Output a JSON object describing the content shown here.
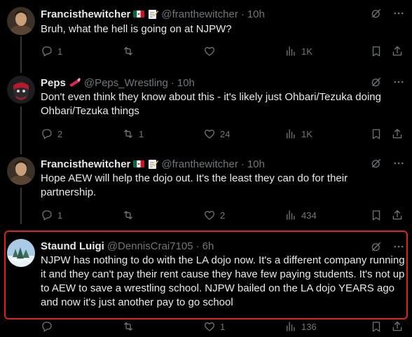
{
  "tweets": [
    {
      "name": "Francisthewitcher",
      "handle": "@franthewitcher",
      "time": "10h",
      "text": "Bruh, what the hell is going on at NJPW?",
      "replies": "1",
      "retweets": "",
      "likes": "",
      "views": "1K"
    },
    {
      "name": "Peps",
      "handle": "@Peps_Wrestling",
      "time": "10h",
      "text": "Don't even think they know about this - it's likely just Ohbari/Tezuka doing Ohbari/Tezuka things",
      "replies": "2",
      "retweets": "1",
      "likes": "24",
      "views": "1K"
    },
    {
      "name": "Francisthewitcher",
      "handle": "@franthewitcher",
      "time": "10h",
      "text": "Hope AEW will help the dojo out. It's the least they can do for their partnership.",
      "replies": "1",
      "retweets": "",
      "likes": "2",
      "views": "434"
    },
    {
      "name": "Staund Luigi",
      "handle": "@DennisCrai7105",
      "time": "6h",
      "text": "NJPW has nothing to do with the LA dojo now. It's a different company running it and they can't pay their rent cause they have few paying students. It's not up to AEW to save a wrestling school. NJPW bailed on the LA dojo YEARS ago and now it's just another pay to go school",
      "replies": "",
      "retweets": "",
      "likes": "1",
      "views": "136"
    }
  ],
  "separator": "·",
  "colors": {
    "background": "#000000",
    "text": "#e7e9ea",
    "muted": "#71767b",
    "highlight_border": "#d9231d"
  },
  "icons": [
    "reply-icon",
    "retweet-icon",
    "like-icon",
    "views-icon",
    "bookmark-icon",
    "share-icon",
    "grok-icon",
    "more-icon"
  ]
}
